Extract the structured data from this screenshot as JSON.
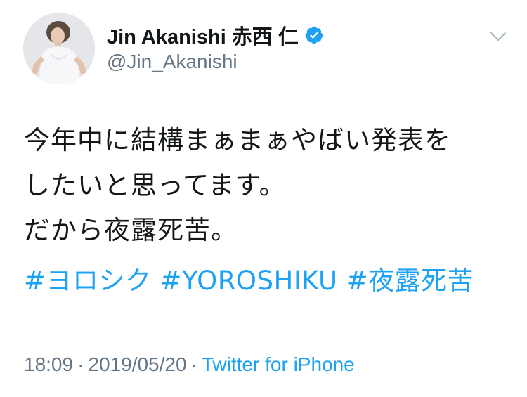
{
  "author": {
    "display_name": "Jin Akanishi 赤西 仁",
    "handle": "@Jin_Akanishi",
    "verified": true
  },
  "tweet": {
    "text_lines": [
      "今年中に結構まぁまぁやばい発表を",
      "したいと思ってます。",
      "だから夜露死苦。"
    ],
    "hashtags": [
      "#ヨロシク",
      "#YOROSHIKU",
      "#夜露死苦"
    ]
  },
  "meta": {
    "time": "18:09",
    "separator": "·",
    "date": "2019/05/20",
    "source": "Twitter for iPhone"
  },
  "icons": {
    "verified": "verified-badge-icon",
    "caret": "chevron-down-icon"
  },
  "colors": {
    "link": "#1da1f2",
    "secondary_text": "#657786",
    "primary_text": "#14171a"
  }
}
